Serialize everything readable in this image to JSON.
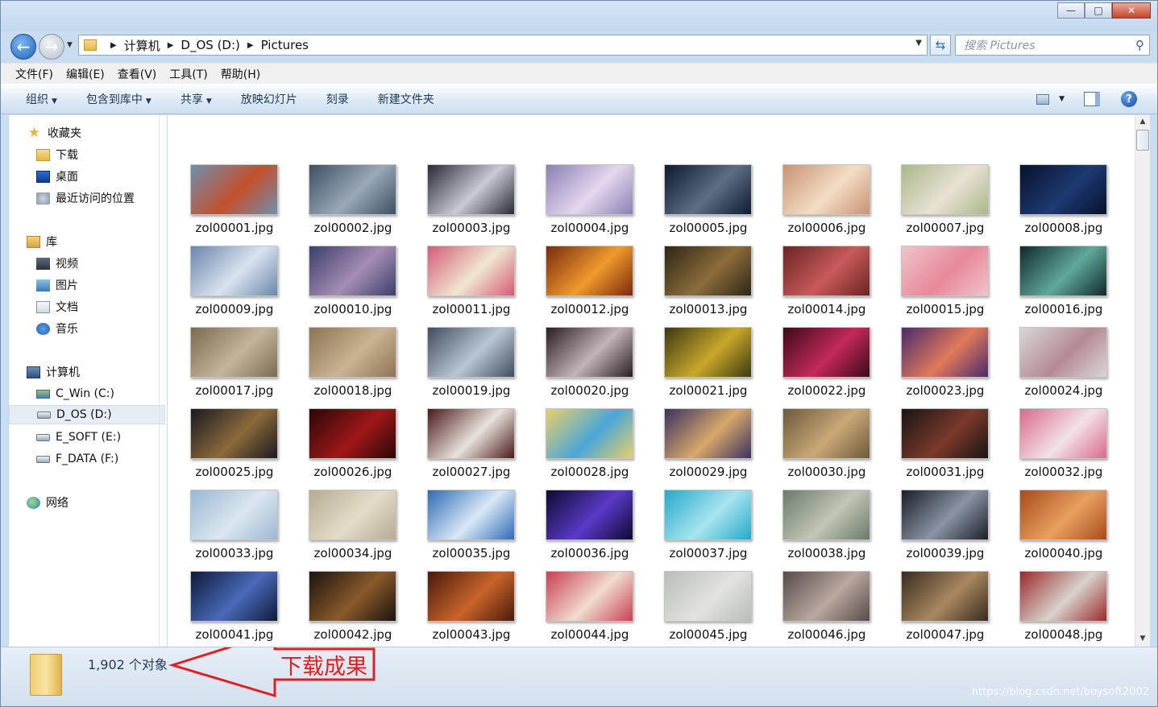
{
  "window": {
    "minimize_label": "—",
    "maximize_label": "□",
    "close_label": "✕"
  },
  "address": {
    "crumbs": [
      "计算机",
      "D_OS (D:)",
      "Pictures"
    ],
    "search_placeholder": "搜索 Pictures"
  },
  "menu": [
    "文件(F)",
    "编辑(E)",
    "查看(V)",
    "工具(T)",
    "帮助(H)"
  ],
  "commands": [
    {
      "label": "组织",
      "dropdown": true
    },
    {
      "label": "包含到库中",
      "dropdown": true
    },
    {
      "label": "共享",
      "dropdown": true
    },
    {
      "label": "放映幻灯片",
      "dropdown": false
    },
    {
      "label": "刻录",
      "dropdown": false
    },
    {
      "label": "新建文件夹",
      "dropdown": false
    }
  ],
  "nav": {
    "favorites": "收藏夹",
    "downloads": "下载",
    "desktop": "桌面",
    "recent": "最近访问的位置",
    "libraries": "库",
    "videos": "视频",
    "pictures": "图片",
    "documents": "文档",
    "music": "音乐",
    "computer": "计算机",
    "drive_c": "C_Win (C:)",
    "drive_d": "D_OS (D:)",
    "drive_e": "E_SOFT (E:)",
    "drive_f": "F_DATA (F:)",
    "network": "网络"
  },
  "files": [
    {
      "name": "zol00001.jpg",
      "c1": "#6f8fae",
      "c2": "#c4502c"
    },
    {
      "name": "zol00002.jpg",
      "c1": "#3e4f63",
      "c2": "#9aa8b8"
    },
    {
      "name": "zol00003.jpg",
      "c1": "#2a2a35",
      "c2": "#c9c9d6"
    },
    {
      "name": "zol00004.jpg",
      "c1": "#8a7fb3",
      "c2": "#e4d7ee"
    },
    {
      "name": "zol00005.jpg",
      "c1": "#0e1a30",
      "c2": "#5d6e85"
    },
    {
      "name": "zol00006.jpg",
      "c1": "#c99273",
      "c2": "#f2ddc4"
    },
    {
      "name": "zol00007.jpg",
      "c1": "#a9b888",
      "c2": "#e9e1d4"
    },
    {
      "name": "zol00008.jpg",
      "c1": "#07122c",
      "c2": "#1d3a72"
    },
    {
      "name": "zol00009.jpg",
      "c1": "#6a86aa",
      "c2": "#d9e3ef"
    },
    {
      "name": "zol00010.jpg",
      "c1": "#3b3f6c",
      "c2": "#a58db3"
    },
    {
      "name": "zol00011.jpg",
      "c1": "#d35b76",
      "c2": "#f0e7d0"
    },
    {
      "name": "zol00012.jpg",
      "c1": "#7a2a0d",
      "c2": "#f09a2c"
    },
    {
      "name": "zol00013.jpg",
      "c1": "#2d2616",
      "c2": "#8c6d3a"
    },
    {
      "name": "zol00014.jpg",
      "c1": "#6b2424",
      "c2": "#c85a5a"
    },
    {
      "name": "zol00015.jpg",
      "c1": "#efc4cc",
      "c2": "#e88898"
    },
    {
      "name": "zol00016.jpg",
      "c1": "#0f2a2a",
      "c2": "#5fa89a"
    },
    {
      "name": "zol00017.jpg",
      "c1": "#7b6a52",
      "c2": "#c3b59a"
    },
    {
      "name": "zol00018.jpg",
      "c1": "#8c7354",
      "c2": "#c9b493"
    },
    {
      "name": "zol00019.jpg",
      "c1": "#3f4d5e",
      "c2": "#b9c6d3"
    },
    {
      "name": "zol00020.jpg",
      "c1": "#2a1e22",
      "c2": "#c2b3b8"
    },
    {
      "name": "zol00021.jpg",
      "c1": "#3b3a10",
      "c2": "#c9a72a"
    },
    {
      "name": "zol00022.jpg",
      "c1": "#3c0a1a",
      "c2": "#c32a58"
    },
    {
      "name": "zol00023.jpg",
      "c1": "#4a2a6b",
      "c2": "#e07a5a"
    },
    {
      "name": "zol00024.jpg",
      "c1": "#d8d6d9",
      "c2": "#b58a92"
    },
    {
      "name": "zol00025.jpg",
      "c1": "#1a1a22",
      "c2": "#8b6a3a"
    },
    {
      "name": "zol00026.jpg",
      "c1": "#2a0808",
      "c2": "#a01818"
    },
    {
      "name": "zol00027.jpg",
      "c1": "#4a1a1a",
      "c2": "#e8e2dc"
    },
    {
      "name": "zol00028.jpg",
      "c1": "#e8d068",
      "c2": "#4aa6d8"
    },
    {
      "name": "zol00029.jpg",
      "c1": "#3a3260",
      "c2": "#d8a86a"
    },
    {
      "name": "zol00030.jpg",
      "c1": "#6b5a3a",
      "c2": "#c9a878"
    },
    {
      "name": "zol00031.jpg",
      "c1": "#1a1414",
      "c2": "#7a3a2a"
    },
    {
      "name": "zol00032.jpg",
      "c1": "#d86a8a",
      "c2": "#f2e2e8"
    },
    {
      "name": "zol00033.jpg",
      "c1": "#9ab8d3",
      "c2": "#dbe6ef"
    },
    {
      "name": "zol00034.jpg",
      "c1": "#b5ab92",
      "c2": "#e3dcc8"
    },
    {
      "name": "zol00035.jpg",
      "c1": "#2d6bb3",
      "c2": "#d9e8f6"
    },
    {
      "name": "zol00036.jpg",
      "c1": "#0d0a30",
      "c2": "#5a3ac8"
    },
    {
      "name": "zol00037.jpg",
      "c1": "#25a9c9",
      "c2": "#a8e4ef"
    },
    {
      "name": "zol00038.jpg",
      "c1": "#6a7a6a",
      "c2": "#c2c6b6"
    },
    {
      "name": "zol00039.jpg",
      "c1": "#1a1e26",
      "c2": "#8a94a6"
    },
    {
      "name": "zol00040.jpg",
      "c1": "#a84a1a",
      "c2": "#e8a060"
    },
    {
      "name": "zol00041.jpg",
      "c1": "#0e1a3a",
      "c2": "#4a6ab8"
    },
    {
      "name": "zol00042.jpg",
      "c1": "#1a1410",
      "c2": "#8a5a2a"
    },
    {
      "name": "zol00043.jpg",
      "c1": "#4a1a0a",
      "c2": "#c8642a"
    },
    {
      "name": "zol00044.jpg",
      "c1": "#c84050",
      "c2": "#f0dccf"
    },
    {
      "name": "zol00045.jpg",
      "c1": "#b9bcb8",
      "c2": "#e2e3e0"
    },
    {
      "name": "zol00046.jpg",
      "c1": "#5a4a48",
      "c2": "#b8a8a0"
    },
    {
      "name": "zol00047.jpg",
      "c1": "#3a2a20",
      "c2": "#a88860"
    },
    {
      "name": "zol00048.jpg",
      "c1": "#9a2a2a",
      "c2": "#d8d2cc"
    }
  ],
  "status": {
    "count": "1,902 个对象",
    "annotation": "下载成果",
    "watermark": "https://blog.csdn.net/boysoft2002"
  },
  "colors": {
    "accent": "#1e395b",
    "annotation_red": "#e02020"
  }
}
